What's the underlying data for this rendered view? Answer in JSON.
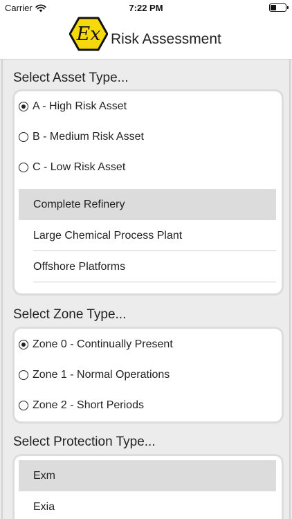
{
  "status_bar": {
    "carrier": "Carrier",
    "time": "7:22 PM"
  },
  "nav": {
    "title": "Risk Assessment",
    "logo_text": "Ex"
  },
  "asset_section": {
    "title": "Select Asset Type...",
    "options": [
      {
        "label": "A - High Risk Asset",
        "selected": true
      },
      {
        "label": "B - Medium Risk Asset",
        "selected": false
      },
      {
        "label": "C - Low Risk Asset",
        "selected": false
      }
    ],
    "list": [
      {
        "label": "Complete Refinery",
        "selected": true
      },
      {
        "label": "Large Chemical Process Plant",
        "selected": false
      },
      {
        "label": "Offshore Platforms",
        "selected": false
      }
    ]
  },
  "zone_section": {
    "title": "Select Zone Type...",
    "options": [
      {
        "label": "Zone 0 - Continually Present",
        "selected": true
      },
      {
        "label": "Zone 1 - Normal Operations",
        "selected": false
      },
      {
        "label": "Zone 2 - Short Periods",
        "selected": false
      }
    ]
  },
  "protection_section": {
    "title": "Select Protection Type...",
    "list": [
      {
        "label": "Exm",
        "selected": true
      },
      {
        "label": "Exia",
        "selected": false
      }
    ]
  },
  "colors": {
    "logo_yellow": "#f5d90a",
    "background": "#ececec",
    "selected_row": "#dcdcdc"
  }
}
